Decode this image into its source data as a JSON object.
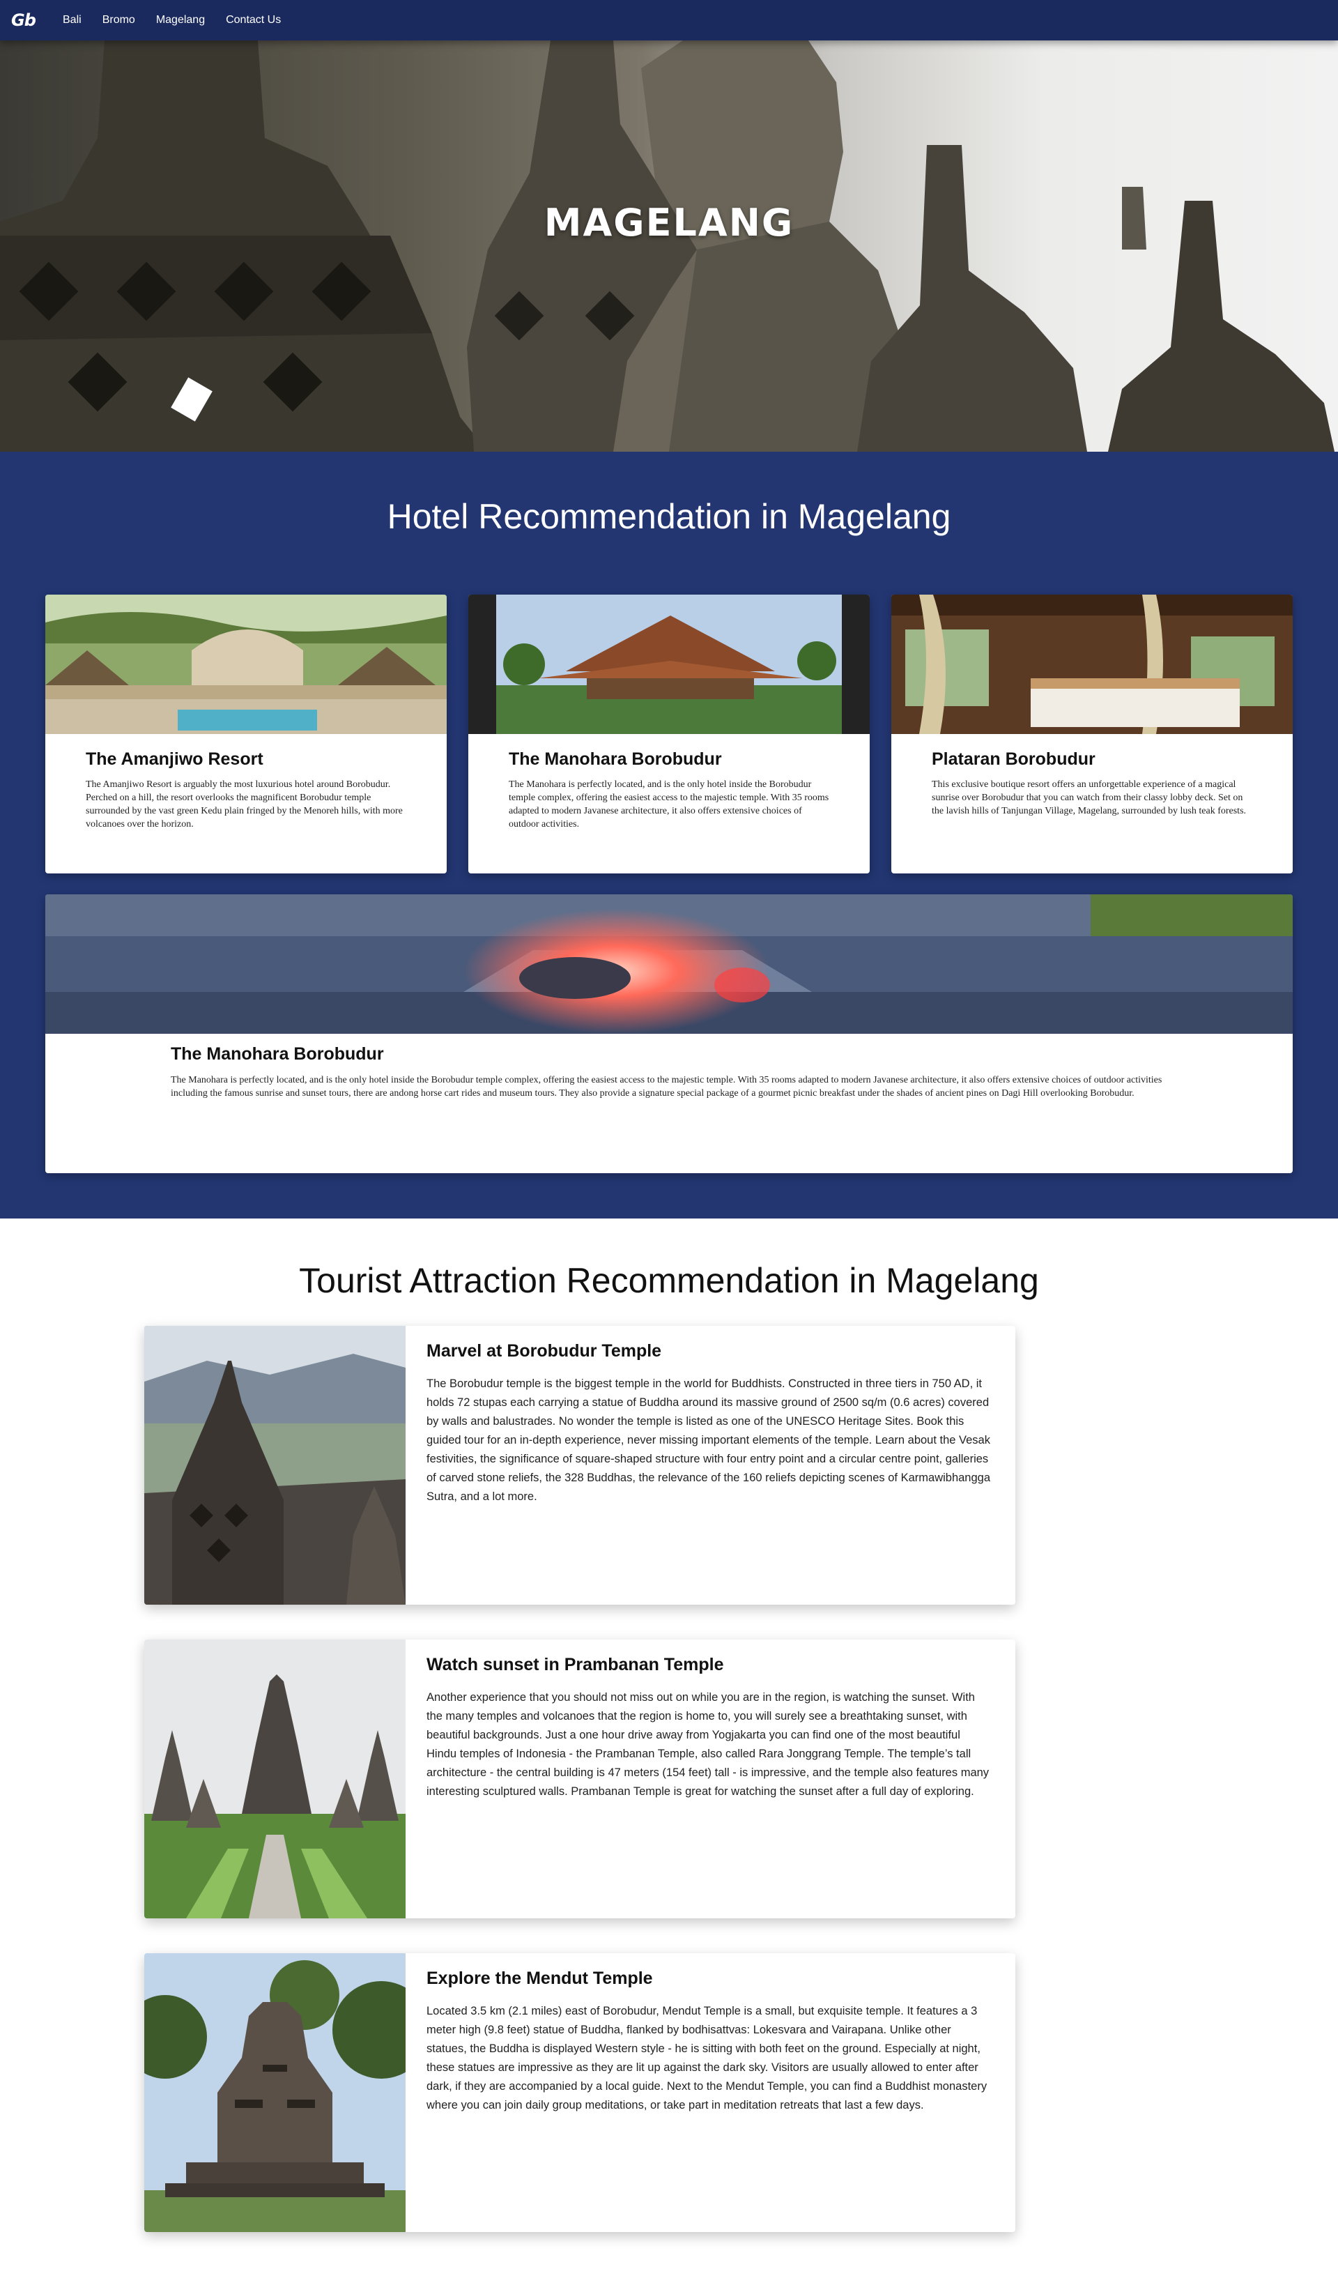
{
  "navbar": {
    "logo": "Gb",
    "links": [
      "Bali",
      "Bromo",
      "Magelang",
      "Contact Us"
    ]
  },
  "hero": {
    "title": "MAGELANG"
  },
  "hotels": {
    "title": "Hotel Recommendation in Magelang",
    "cards": [
      {
        "title": "The Amanjiwo Resort",
        "text": "The Amanjiwo Resort is arguably the most luxurious hotel around Borobudur. Perched on a hill, the resort overlooks the magnificent Borobudur temple surrounded by the vast green Kedu plain fringed by the Menoreh hills, with more volcanoes over the horizon."
      },
      {
        "title": "The Manohara Borobudur",
        "text": "The Manohara is perfectly located, and is the only hotel inside the Borobudur temple complex, offering the easiest access to the majestic temple. With 35 rooms adapted to modern Javanese architecture, it also offers extensive choices of outdoor activities."
      },
      {
        "title": "Plataran Borobudur",
        "text": "This exclusive boutique resort offers an unforgettable experience of a magical sunrise over Borobudur that you can watch from their classy lobby deck. Set on the lavish hills of Tanjungan Village, Magelang, surrounded by lush teak forests."
      },
      {
        "title": "The Manohara Borobudur",
        "text": "The Manohara is perfectly located, and is the only hotel inside the Borobudur temple complex, offering the easiest access to the majestic temple. With 35 rooms adapted to modern Javanese architecture, it also offers extensive choices of outdoor activities including the famous sunrise and sunset tours, there are andong horse cart rides and museum tours. They also provide a signature special package of a gourmet picnic breakfast under the shades of ancient pines on Dagi Hill overlooking Borobudur."
      }
    ]
  },
  "attractions": {
    "title": "Tourist Attraction Recommendation in Magelang",
    "cards": [
      {
        "title": "Marvel at Borobudur Temple",
        "text": "The Borobudur temple is the biggest temple in the world for Buddhists. Constructed in three tiers in 750 AD, it holds 72 stupas each carrying a statue of Buddha around its massive ground of 2500 sq/m (0.6 acres) covered by walls and balustrades. No wonder the temple is listed as one of the UNESCO Heritage Sites. Book this guided tour for an in-depth experience, never missing important elements of the temple. Learn about the Vesak festivities, the significance of square-shaped structure with four entry point and a circular centre point, galleries of carved stone reliefs, the 328 Buddhas, the relevance of the 160 reliefs depicting scenes of Karmawibhangga Sutra, and a lot more."
      },
      {
        "title": "Watch sunset in Prambanan Temple",
        "text": "Another experience that you should not miss out on while you are in the region, is watching the sunset. With the many temples and volcanoes that the region is home to, you will surely see a breathtaking sunset, with beautiful backgrounds. Just a one hour drive away from Yogjakarta you can find one of the most beautiful Hindu temples of Indonesia - the Prambanan Temple, also called Rara Jonggrang Temple. The temple’s tall architecture - the central building is 47 meters (154 feet) tall - is impressive, and the temple also features many interesting sculptured walls. Prambanan Temple is great for watching the sunset after a full day of exploring."
      },
      {
        "title": "Explore the Mendut Temple",
        "text": "Located 3.5 km (2.1 miles) east of Borobudur, Mendut Temple is a small, but exquisite temple. It features a 3 meter high (9.8 feet) statue of Buddha, flanked by bodhisattvas: Lokesvara and Vairapana. Unlike other statues, the Buddha is displayed Western style - he is sitting with both feet on the ground. Especially at night, these statues are impressive as they are lit up against the dark sky. Visitors are usually allowed to enter after dark, if they are accompanied by a local guide. Next to the Mendut Temple, you can find a Buddhist monastery where you can join daily group meditations, or take part in meditation retreats that last a few days."
      }
    ]
  }
}
